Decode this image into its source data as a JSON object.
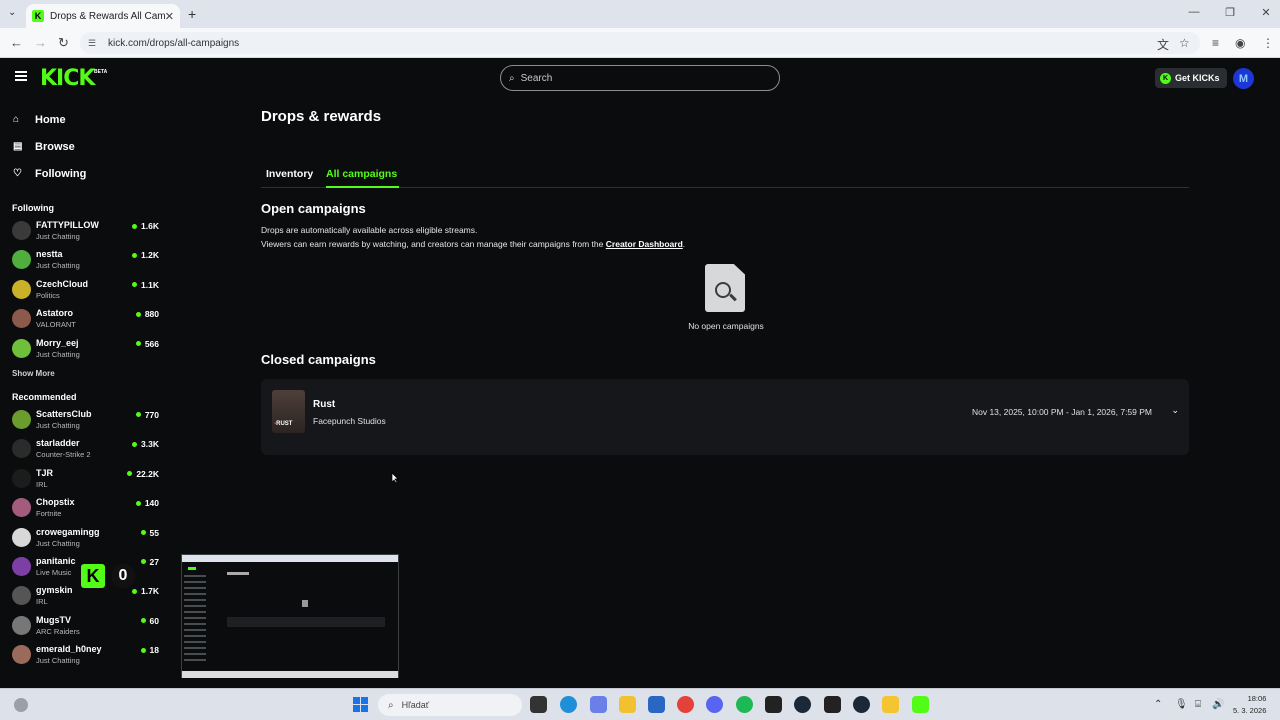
{
  "browser": {
    "tab_title": "Drops & Rewards All Campaig",
    "tab_close": "✕",
    "new_tab": "+",
    "url": "kick.com/drops/all-campaigns"
  },
  "header": {
    "logo": "KICK",
    "logo_badge": "BETA",
    "search_placeholder": "Search",
    "get_kicks_label": "Get KICKs",
    "avatar_initial": "M"
  },
  "nav": {
    "home": "Home",
    "browse": "Browse",
    "following": "Following"
  },
  "following_section": {
    "heading": "Following",
    "channels": [
      {
        "name": "FATTYPILLOW",
        "category": "Just Chatting",
        "viewers": "1.6K",
        "color": "#3a3a3a"
      },
      {
        "name": "nestta",
        "category": "Just Chatting",
        "viewers": "1.2K",
        "color": "#4fae3e"
      },
      {
        "name": "CzechCloud",
        "category": "Politics",
        "viewers": "1.1K",
        "color": "#c9b12a"
      },
      {
        "name": "Astatoro",
        "category": "VALORANT",
        "viewers": "880",
        "color": "#8c5a4a"
      },
      {
        "name": "Morry_eej",
        "category": "Just Chatting",
        "viewers": "566",
        "color": "#6fbf3b"
      }
    ],
    "show_more": "Show More"
  },
  "recommended_section": {
    "heading": "Recommended",
    "channels": [
      {
        "name": "ScattersClub",
        "category": "Just Chatting",
        "viewers": "770",
        "color": "#6a9d2e"
      },
      {
        "name": "starladder",
        "category": "Counter-Strike 2",
        "viewers": "3.3K",
        "color": "#2b2b2b"
      },
      {
        "name": "TJR",
        "category": "IRL",
        "viewers": "22.2K",
        "color": "#1c1c1c"
      },
      {
        "name": "Chopstix",
        "category": "Fortnite",
        "viewers": "140",
        "color": "#a35c7d"
      },
      {
        "name": "crowegamingg",
        "category": "Just Chatting",
        "viewers": "55",
        "color": "#d8d8d8"
      },
      {
        "name": "panitanic",
        "category": "Live Music",
        "viewers": "27",
        "color": "#7d3fa6"
      },
      {
        "name": "gymskin",
        "category": "IRL",
        "viewers": "1.7K",
        "color": "#555555"
      },
      {
        "name": "MugsTV",
        "category": "ARC Raiders",
        "viewers": "60",
        "color": "#777777"
      },
      {
        "name": "emerald_h0ney",
        "category": "Just Chatting",
        "viewers": "18",
        "color": "#9a6b5a"
      }
    ]
  },
  "page": {
    "title": "Drops & rewards",
    "tabs": {
      "inventory": "Inventory",
      "all_campaigns": "All campaigns"
    },
    "open_campaigns": {
      "title": "Open campaigns",
      "desc_line1": "Drops are automatically available across eligible streams.",
      "desc_line2": "Viewers can earn rewards by watching, and creators can manage their campaigns from the",
      "dashboard_link": "Creator Dashboard",
      "desc_end": ".",
      "empty_text": "No open campaigns"
    },
    "closed_campaigns": {
      "title": "Closed campaigns",
      "items": [
        {
          "game": "Rust",
          "studio": "Facepunch Studios",
          "dates": "Nov 13, 2025, 10:00 PM - Jan 1, 2026, 7:59 PM",
          "thumb_logo": "RUST"
        }
      ]
    }
  },
  "overlay": {
    "kick_letter": "K",
    "count": "0"
  },
  "taskbar": {
    "search_label": "Hľadať",
    "time": "18:06",
    "date": "5. 3. 2026"
  },
  "colors": {
    "accent": "#53fc18",
    "background": "#0b0c0d"
  }
}
